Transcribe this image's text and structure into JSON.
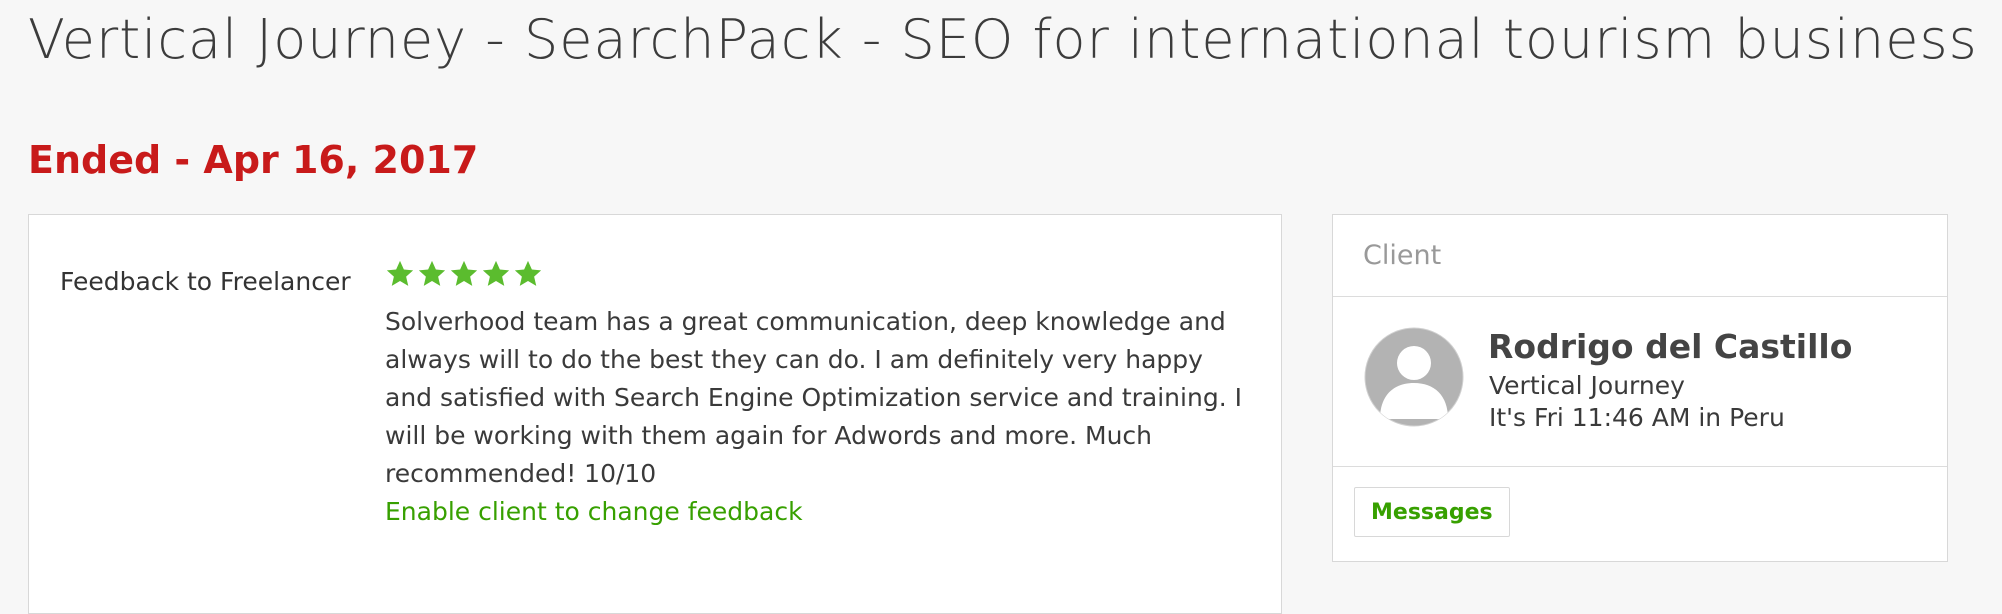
{
  "page": {
    "title": "Vertical Journey - SearchPack - SEO for international tourism business",
    "status": "Ended - Apr 16, 2017"
  },
  "feedback": {
    "label": "Feedback to Freelancer",
    "rating": 5,
    "rating_max": 5,
    "star_color": "#5bbc2e",
    "text": "Solverhood team has a great communication, deep knowledge and always will to do the best they can do. I am definitely very happy and satisfied with Search Engine Optimization service and training. I will be working with them again for Adwords and more. Much recommended! 10/10",
    "action_link": "Enable client to change feedback"
  },
  "client": {
    "header": "Client",
    "avatar_icon": "default-user-avatar-icon",
    "name": "Rodrigo del Castillo",
    "company": "Vertical Journey",
    "local_time": "It's Fri 11:46 AM in Peru",
    "messages_button": "Messages"
  },
  "colors": {
    "accent_green": "#37a000",
    "status_red": "#c81a1a",
    "page_bg": "#f7f7f7"
  }
}
